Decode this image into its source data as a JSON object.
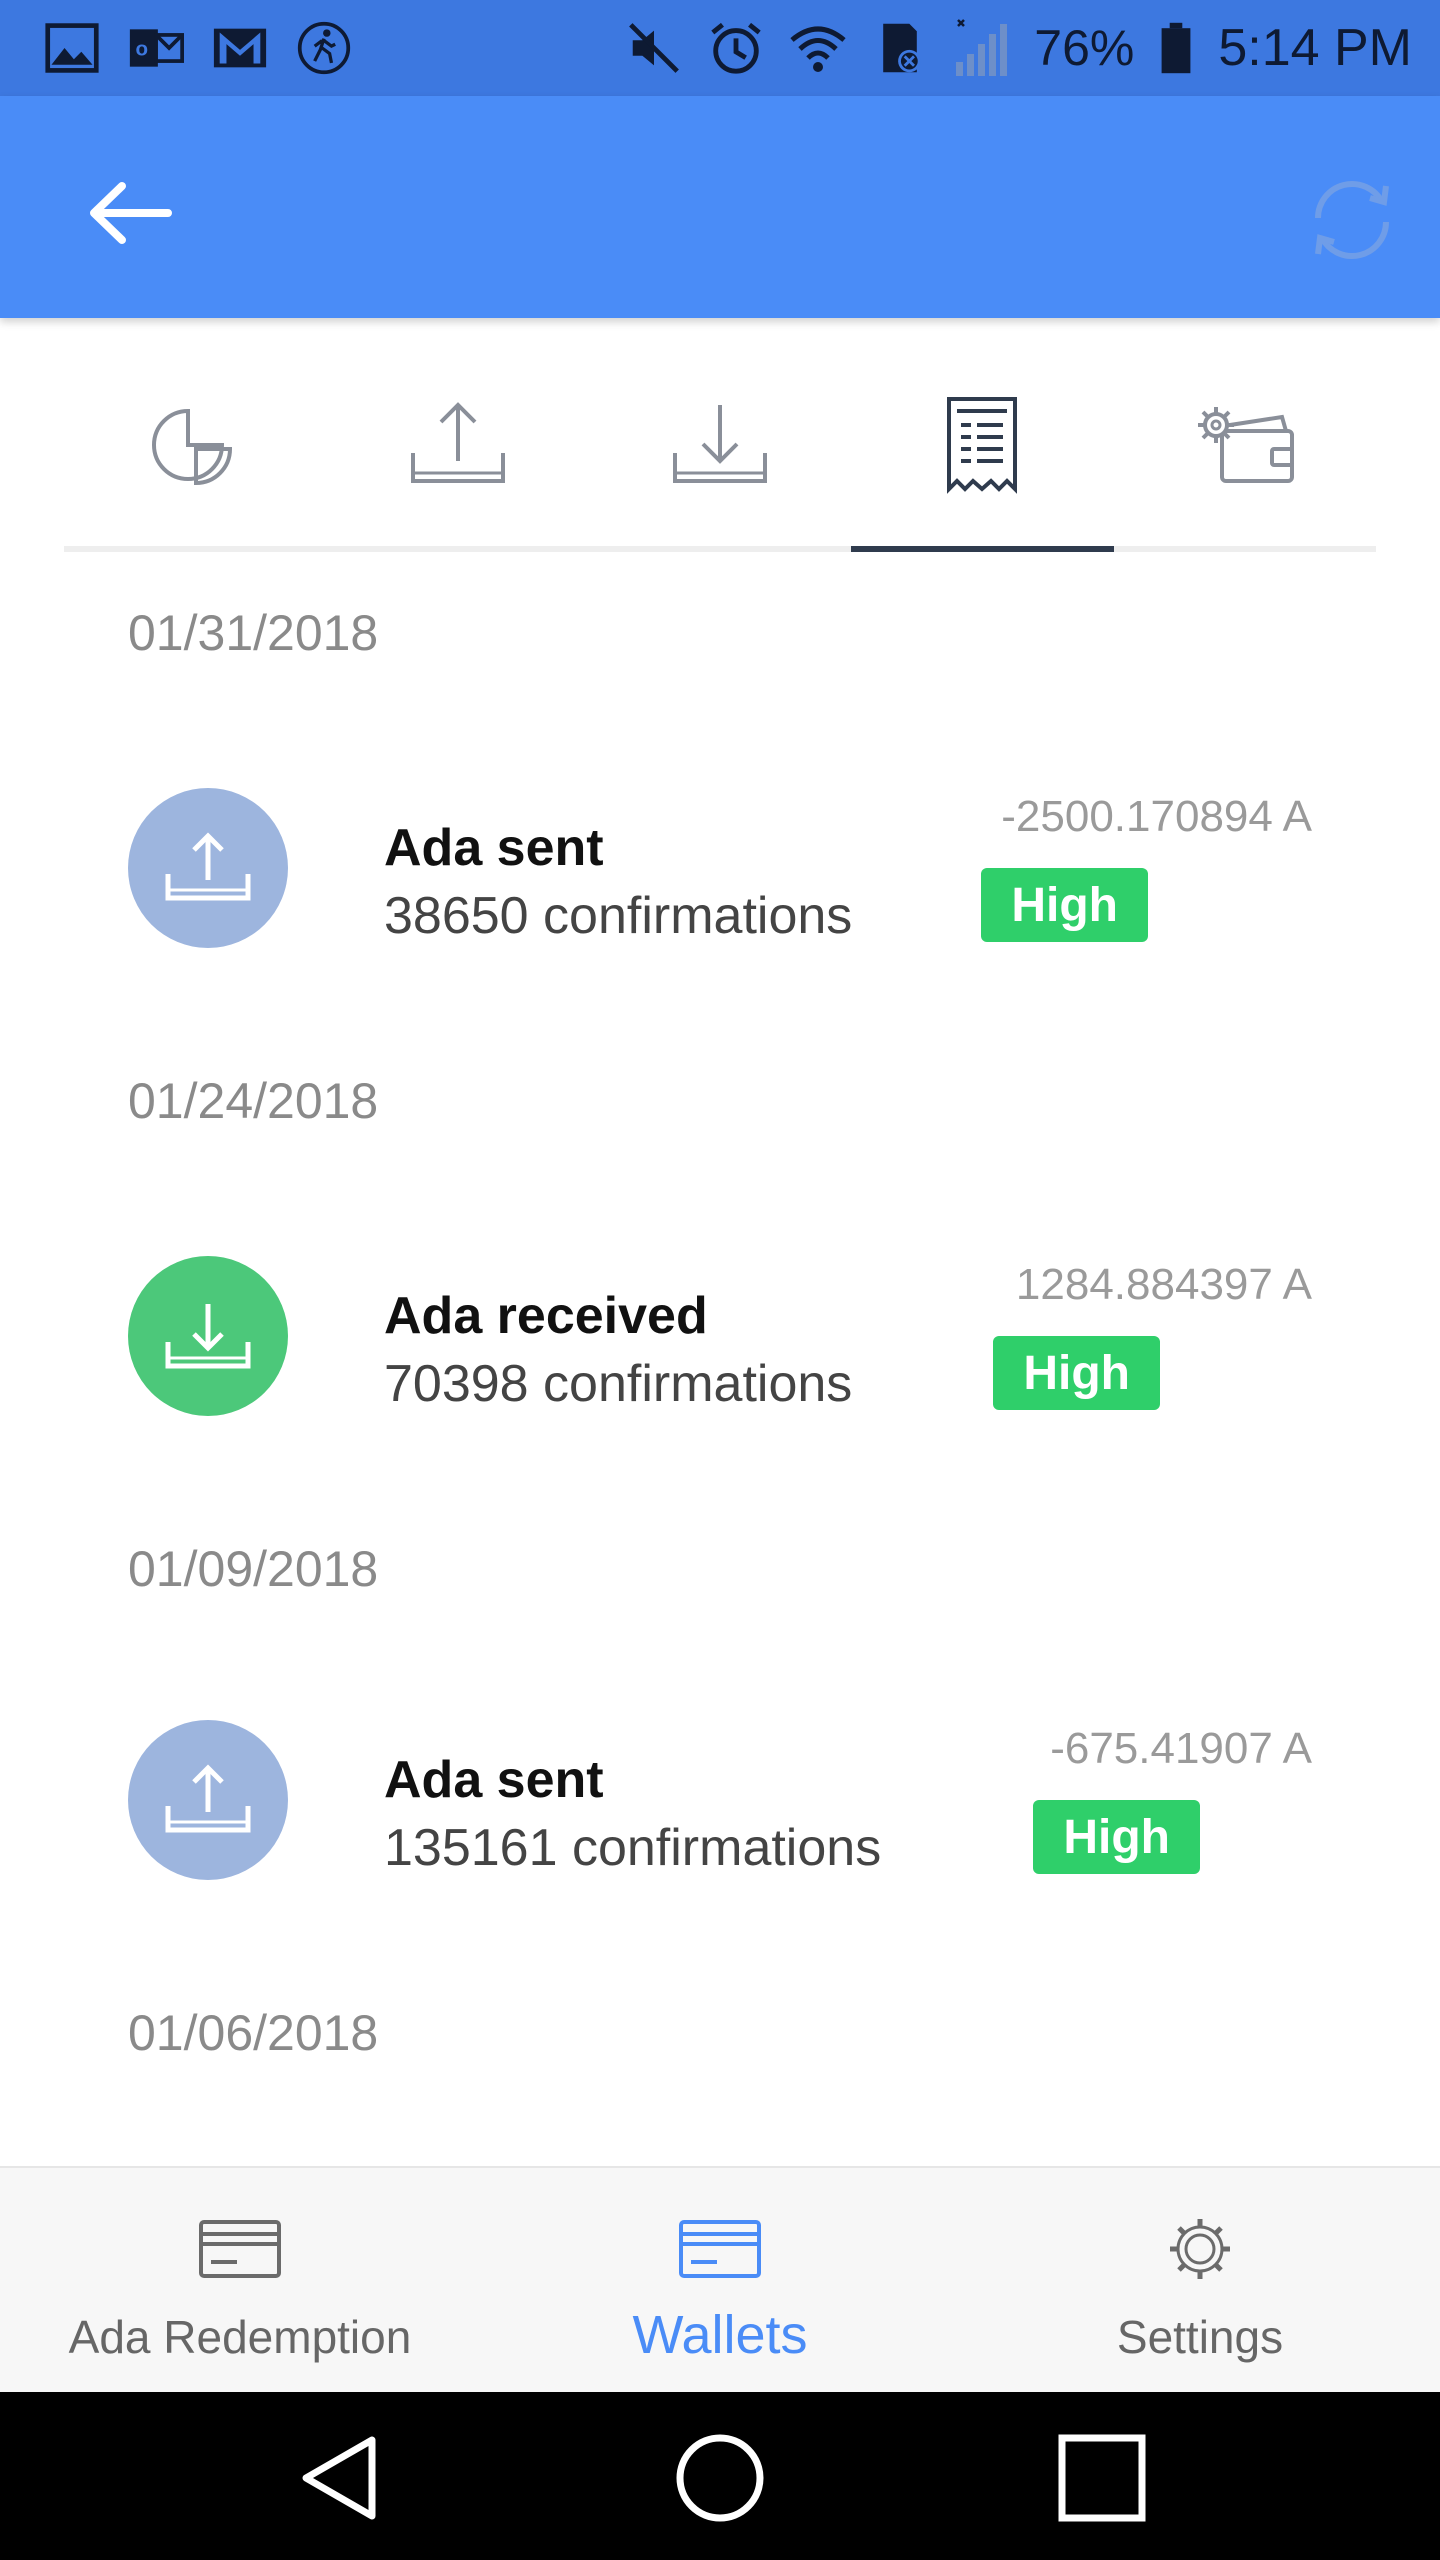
{
  "status_bar": {
    "battery": "76%",
    "time": "5:14 PM",
    "left_icons": [
      "gallery-icon",
      "outlook-icon",
      "gmail-icon",
      "walk-icon"
    ],
    "right_icons": [
      "mute-icon",
      "alarm-icon",
      "wifi-icon",
      "sd-card-icon",
      "signal-icon",
      "battery-icon"
    ]
  },
  "app_bar": {
    "back_icon": "arrow-left-icon",
    "refresh_icon": "refresh-icon"
  },
  "tabs": [
    {
      "id": "summary",
      "icon": "pie-chart-icon",
      "active": false
    },
    {
      "id": "send",
      "icon": "upload-icon",
      "active": false
    },
    {
      "id": "receive",
      "icon": "download-icon",
      "active": false
    },
    {
      "id": "transactions",
      "icon": "receipt-icon",
      "active": true
    },
    {
      "id": "wallet-settings",
      "icon": "gear-wallet-icon",
      "active": false
    }
  ],
  "transactions": [
    {
      "date": "01/31/2018",
      "title": "Ada sent",
      "confirmations": "38650 confirmations",
      "amount": "-2500.170894 A",
      "badge": "High",
      "type": "sent"
    },
    {
      "date": "01/24/2018",
      "title": "Ada received",
      "confirmations": "70398 confirmations",
      "amount": "1284.884397 A",
      "badge": "High",
      "type": "received"
    },
    {
      "date": "01/09/2018",
      "title": "Ada sent",
      "confirmations": "135161 confirmations",
      "amount": "-675.41907 A",
      "badge": "High",
      "type": "sent"
    }
  ],
  "trailing_date": "01/06/2018",
  "colors": {
    "status_bar": "#3d78e0",
    "app_bar": "#4a8cf7",
    "sent_avatar": "#9db5de",
    "received_avatar": "#4cc87a",
    "badge": "#2fcf6a",
    "active_tab_underline": "#2f3b4d"
  },
  "bottom_nav": {
    "items": [
      {
        "label": "Ada Redemption",
        "icon": "card-icon",
        "active": false
      },
      {
        "label": "Wallets",
        "icon": "wallet-card-icon",
        "active": true
      },
      {
        "label": "Settings",
        "icon": "gear-icon",
        "active": false
      }
    ]
  },
  "system_nav": [
    "back-triangle-icon",
    "home-circle-icon",
    "recents-square-icon"
  ]
}
